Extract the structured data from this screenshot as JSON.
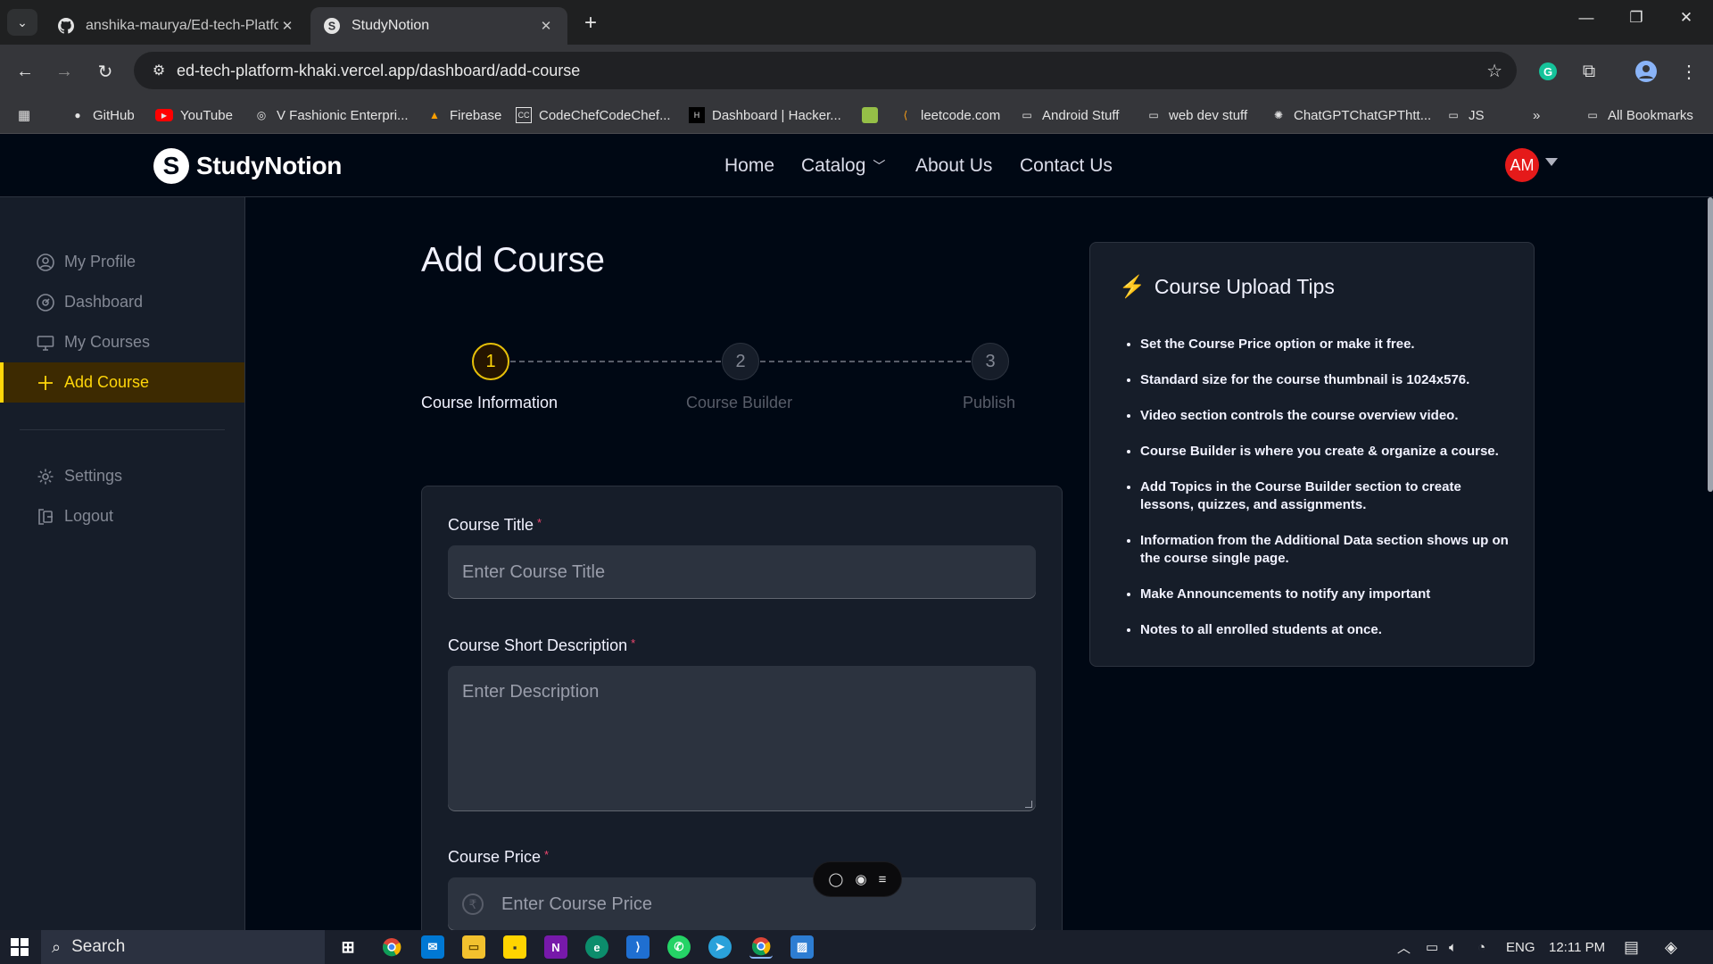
{
  "browser": {
    "tabs": [
      {
        "title": "anshika-maurya/Ed-tech-Platfo",
        "favicon": "github-icon",
        "active": false
      },
      {
        "title": "StudyNotion",
        "favicon": "studynotion-icon",
        "active": true
      }
    ],
    "url": "ed-tech-platform-khaki.vercel.app/dashboard/add-course",
    "bookmarks": [
      {
        "label": "GitHub",
        "icon": "github-icon"
      },
      {
        "label": "YouTube",
        "icon": "youtube-icon"
      },
      {
        "label": "V Fashionic Enterpri...",
        "icon": "globe-icon"
      },
      {
        "label": "Firebase",
        "icon": "firebase-icon"
      },
      {
        "label": "CodeChefCodeChef...",
        "icon": "codechef-icon"
      },
      {
        "label": "Dashboard | Hacker...",
        "icon": "hackerrank-icon"
      },
      {
        "label": "",
        "icon": "shopify-icon"
      },
      {
        "label": "leetcode.com",
        "icon": "leetcode-icon"
      },
      {
        "label": "Android Stuff",
        "icon": "folder-icon"
      },
      {
        "label": "web dev stuff",
        "icon": "folder-icon"
      },
      {
        "label": "ChatGPTChatGPThtt...",
        "icon": "chatgpt-icon"
      },
      {
        "label": "JS",
        "icon": "folder-icon"
      }
    ],
    "all_bookmarks": "All Bookmarks"
  },
  "site": {
    "brand": "StudyNotion",
    "nav": [
      "Home",
      "Catalog",
      "About Us",
      "Contact Us"
    ],
    "avatar_initials": "AM"
  },
  "sidebar": {
    "items": [
      {
        "label": "My Profile",
        "icon": "user-circle-icon",
        "active": false
      },
      {
        "label": "Dashboard",
        "icon": "dashboard-gauge-icon",
        "active": false
      },
      {
        "label": "My Courses",
        "icon": "monitor-icon",
        "active": false
      },
      {
        "label": "Add Course",
        "icon": "plus-icon",
        "active": true
      }
    ],
    "bottom_items": [
      {
        "label": "Settings",
        "icon": "gear-icon"
      },
      {
        "label": "Logout",
        "icon": "logout-icon"
      }
    ]
  },
  "main": {
    "title": "Add Course",
    "steps": [
      {
        "number": "1",
        "label": "Course Information",
        "active": true
      },
      {
        "number": "2",
        "label": "Course Builder",
        "active": false
      },
      {
        "number": "3",
        "label": "Publish",
        "active": false
      }
    ],
    "form": {
      "course_title": {
        "label": "Course Title",
        "required": "*",
        "placeholder": "Enter Course Title"
      },
      "short_description": {
        "label": "Course Short Description",
        "required": "*",
        "placeholder": "Enter Description"
      },
      "price": {
        "label": "Course Price",
        "required": "*",
        "placeholder": "Enter Course Price",
        "currency_icon": "rupee-icon"
      }
    }
  },
  "tips": {
    "title": "Course Upload Tips",
    "items": [
      "Set the Course Price option or make it free.",
      "Standard size for the course thumbnail is 1024x576.",
      "Video section controls the course overview video.",
      "Course Builder is where you create & organize a course.",
      "Add Topics in the Course Builder section to create lessons, quizzes, and assignments.",
      "Information from the Additional Data section shows up on the course single page.",
      "Make Announcements to notify any important",
      "Notes to all enrolled students at once."
    ]
  },
  "taskbar": {
    "search": "Search",
    "language": "ENG",
    "time": "12:11 PM"
  },
  "colors": {
    "yellow_accent": "#FFD60A",
    "bg": "#000814",
    "card": "#161D29",
    "required": "#EF476F",
    "avatar": "#e51a1a"
  }
}
